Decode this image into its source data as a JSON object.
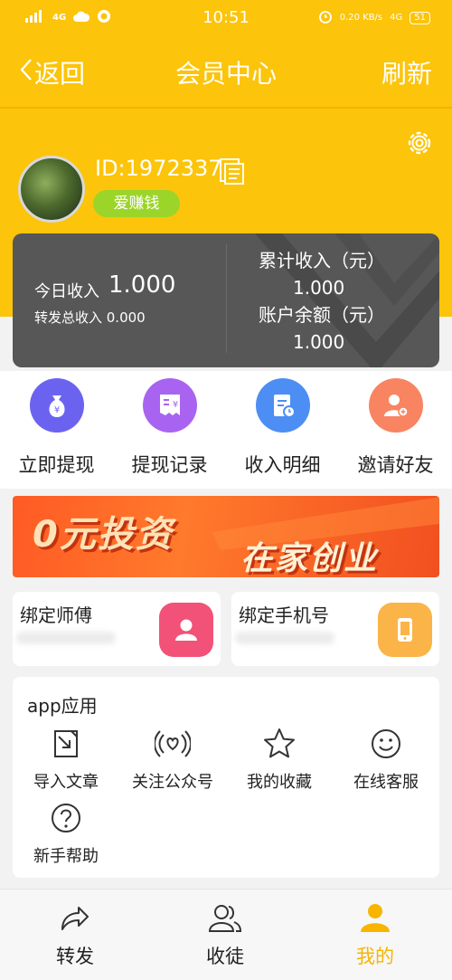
{
  "status_bar": {
    "network": "4G",
    "time": "10:51",
    "speed": "0.20 KB/s",
    "signal": "4G",
    "battery": "51"
  },
  "header": {
    "back_label": "返回",
    "title": "会员中心",
    "refresh_label": "刷新"
  },
  "profile": {
    "id_text": "ID:1972337",
    "badge": "爱赚钱"
  },
  "earnings": {
    "today_label": "今日收入",
    "today_value": "1.000",
    "forward_text": "转发总收入 0.000",
    "total_label": "累计收入（元）",
    "total_value": "1.000",
    "balance_label": "账户余额（元）",
    "balance_value": "1.000"
  },
  "actions": [
    {
      "label": "立即提现",
      "icon": "money-bag-icon",
      "color": "#6b63f0"
    },
    {
      "label": "提现记录",
      "icon": "receipt-icon",
      "color": "#a864f0"
    },
    {
      "label": "收入明细",
      "icon": "document-clock-icon",
      "color": "#4c8ef3"
    },
    {
      "label": "邀请好友",
      "icon": "add-user-icon",
      "color": "#f88461"
    }
  ],
  "banner": {
    "line1": "0元投资",
    "line2": "在家创业"
  },
  "bind_cards": [
    {
      "label": "绑定师傅",
      "icon": "user-icon",
      "color": "#f25277"
    },
    {
      "label": "绑定手机号",
      "icon": "phone-icon",
      "color": "#fbb447"
    }
  ],
  "apps": {
    "heading": "app应用",
    "items": [
      {
        "label": "导入文章",
        "icon": "import-icon"
      },
      {
        "label": "关注公众号",
        "icon": "broadcast-heart-icon"
      },
      {
        "label": "我的收藏",
        "icon": "star-icon"
      },
      {
        "label": "在线客服",
        "icon": "smiley-icon"
      },
      {
        "label": "新手帮助",
        "icon": "question-icon"
      }
    ]
  },
  "nav": {
    "items": [
      {
        "label": "转发",
        "icon": "share-icon"
      },
      {
        "label": "收徒",
        "icon": "users-icon"
      },
      {
        "label": "我的",
        "icon": "person-icon"
      }
    ],
    "active_color": "#f7b500"
  }
}
